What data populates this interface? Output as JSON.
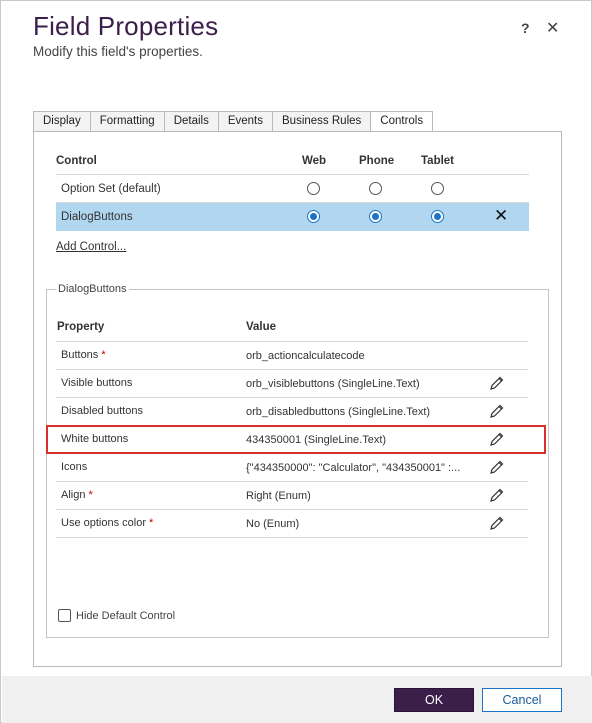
{
  "dialog": {
    "title": "Field Properties",
    "subtitle": "Modify this field's properties.",
    "help_label": "?",
    "close_label": "✕"
  },
  "tabs": [
    {
      "label": "Display",
      "active": false
    },
    {
      "label": "Formatting",
      "active": false
    },
    {
      "label": "Details",
      "active": false
    },
    {
      "label": "Events",
      "active": false
    },
    {
      "label": "Business Rules",
      "active": false
    },
    {
      "label": "Controls",
      "active": true
    }
  ],
  "controls": {
    "headers": {
      "control": "Control",
      "web": "Web",
      "phone": "Phone",
      "tablet": "Tablet"
    },
    "rows": [
      {
        "name": "Option Set (default)",
        "web": false,
        "phone": false,
        "tablet": false,
        "selected": false
      },
      {
        "name": "DialogButtons",
        "web": true,
        "phone": true,
        "tablet": true,
        "selected": true
      }
    ],
    "add_control_label": "Add Control..."
  },
  "properties": {
    "legend": "DialogButtons",
    "headers": {
      "property": "Property",
      "value": "Value"
    },
    "rows": [
      {
        "name": "Buttons",
        "required": "*",
        "value": "orb_actioncalculatecode",
        "editable": false
      },
      {
        "name": "Visible buttons",
        "required": "",
        "value": "orb_visiblebuttons (SingleLine.Text)",
        "editable": true
      },
      {
        "name": "Disabled buttons",
        "required": "",
        "value": "orb_disabledbuttons (SingleLine.Text)",
        "editable": true
      },
      {
        "name": "White buttons",
        "required": "",
        "value": "434350001 (SingleLine.Text)",
        "editable": true
      },
      {
        "name": "Icons",
        "required": "",
        "value": "{\"434350000\": \"Calculator\", \"434350001\" :...",
        "editable": true
      },
      {
        "name": "Align",
        "required": "*",
        "value": "Right (Enum)",
        "editable": true
      },
      {
        "name": "Use options color",
        "required": "*",
        "value": "No (Enum)",
        "editable": true
      }
    ],
    "hide_default_label": "Hide Default Control",
    "hide_default_checked": false
  },
  "footer": {
    "ok_label": "OK",
    "cancel_label": "Cancel"
  },
  "colors": {
    "brand": "#3b1e4a",
    "selected_row": "#b1d6f0",
    "highlight": "#d9302c",
    "radio_on": "#1a73c8"
  }
}
